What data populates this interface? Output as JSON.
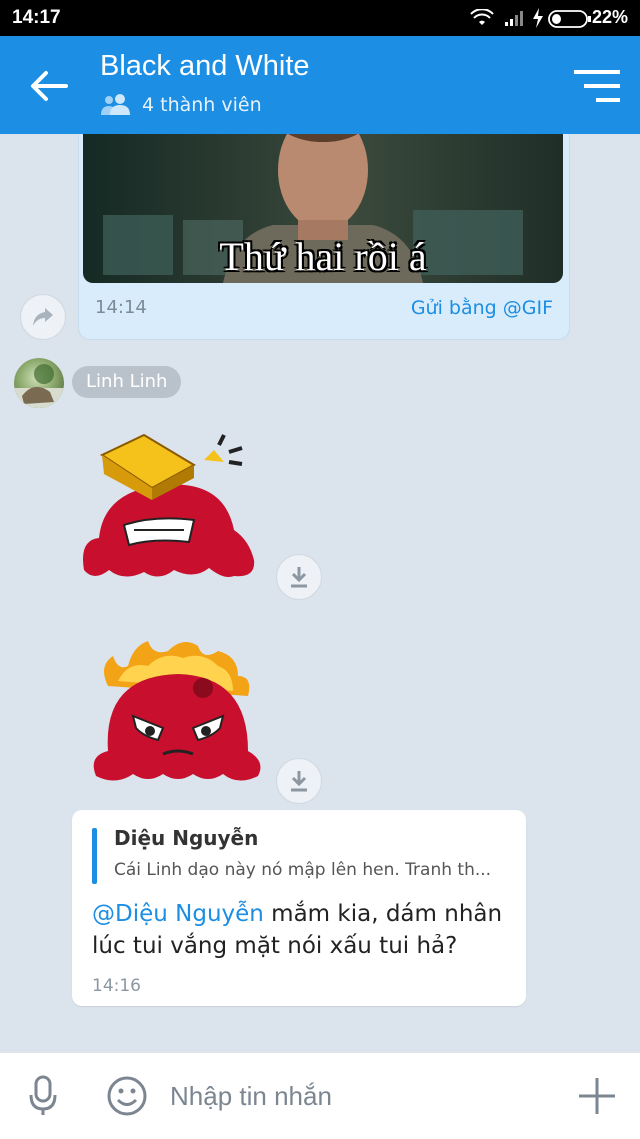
{
  "status_bar": {
    "time": "14:17",
    "battery": "22%"
  },
  "header": {
    "title": "Black and White",
    "members": "4 thành viên"
  },
  "messages": {
    "gif": {
      "caption": "Thứ hai rồi á",
      "time": "14:14",
      "source": "Gửi bằng @GIF"
    },
    "sender": "Linh Linh",
    "reply": {
      "quoted_name": "Diệu Nguyễn",
      "quoted_text": "Cái Linh dạo này nó mập lên hen. Tranh th...",
      "mention": "@Diệu Nguyễn",
      "text": " mắm kia, dám nhân lúc tui vắng mặt nói xấu tui hả?",
      "time": "14:16"
    }
  },
  "composer": {
    "placeholder": "Nhập tin nhắn"
  },
  "colors": {
    "accent": "#1c8ee3",
    "background": "#dbe3ec"
  }
}
